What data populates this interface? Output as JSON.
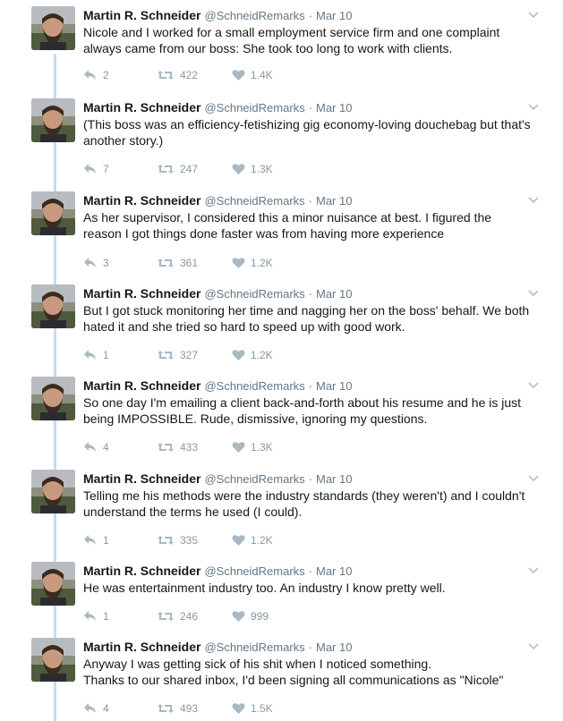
{
  "author": {
    "name": "Martin R. Schneider",
    "handle": "@SchneidRemarks",
    "separator": "·",
    "avatar_icon": "bearded-man-avatar"
  },
  "colors": {
    "thread_line": "#c3dcef",
    "muted": "#8899a6",
    "text": "#14171a"
  },
  "tweets": [
    {
      "date": "Mar 10",
      "lines": [
        "Nicole and I worked for a small employment service firm and one complaint",
        "always came from our boss: She took too long to work with clients."
      ],
      "replies": "2",
      "retweets": "422",
      "likes": "1.4K"
    },
    {
      "date": "Mar 10",
      "lines": [
        "(This boss was an efficiency-fetishizing gig economy-loving douchebag but that's",
        "another story.)"
      ],
      "replies": "7",
      "retweets": "247",
      "likes": "1.3K"
    },
    {
      "date": "Mar 10",
      "lines": [
        "As her supervisor, I considered this a minor nuisance at best. I figured the",
        "reason I got things done faster was from having more experience"
      ],
      "replies": "3",
      "retweets": "361",
      "likes": "1.2K"
    },
    {
      "date": "Mar 10",
      "lines": [
        "But I got stuck monitoring her time and nagging her on the boss' behalf. We both",
        "hated it and she tried so hard to speed up with good work."
      ],
      "replies": "1",
      "retweets": "327",
      "likes": "1.2K"
    },
    {
      "date": "Mar 10",
      "lines": [
        "So one day I'm emailing a client back-and-forth about his resume and he is just",
        "being IMPOSSIBLE. Rude, dismissive, ignoring my questions."
      ],
      "replies": "4",
      "retweets": "433",
      "likes": "1.3K"
    },
    {
      "date": "Mar 10",
      "lines": [
        "Telling me his methods were the industry standards (they weren't) and I couldn't",
        "understand the terms he used (I could)."
      ],
      "replies": "1",
      "retweets": "335",
      "likes": "1.2K"
    },
    {
      "date": "Mar 10",
      "lines": [
        "He was entertainment industry too. An industry I know pretty well."
      ],
      "replies": "1",
      "retweets": "246",
      "likes": "999"
    },
    {
      "date": "Mar 10",
      "lines": [
        "Anyway I was getting sick of his shit when I noticed something.",
        "Thanks to our shared inbox, I'd been signing all communications as \"Nicole\""
      ],
      "replies": "4",
      "retweets": "493",
      "likes": "1.5K"
    }
  ]
}
